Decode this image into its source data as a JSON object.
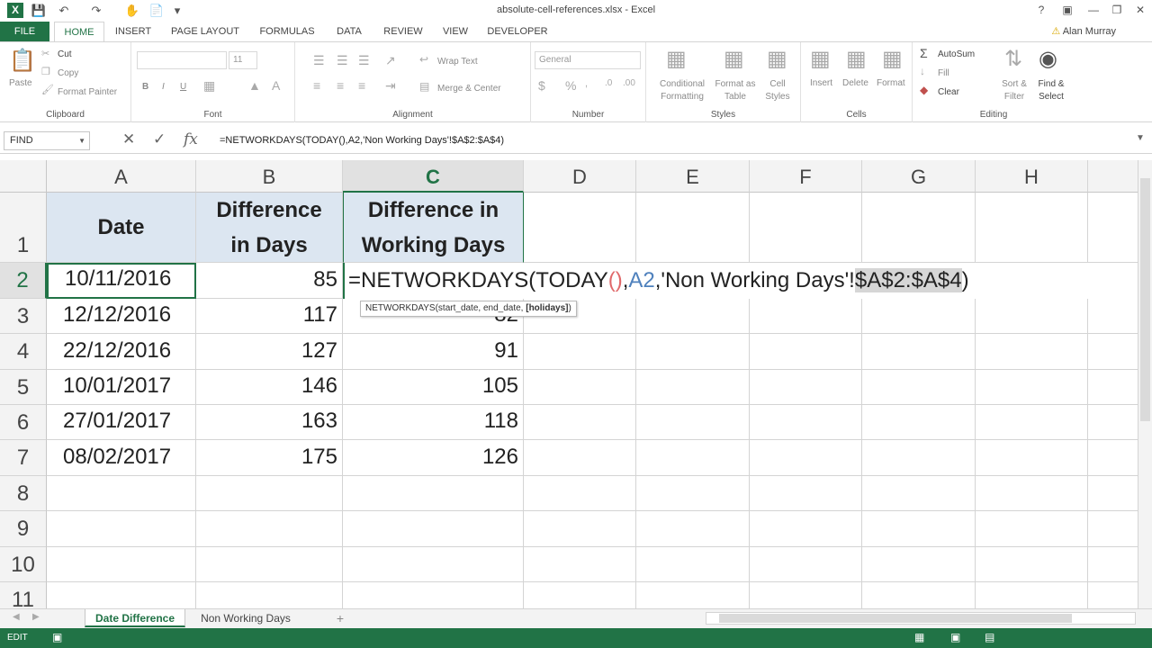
{
  "titlebar": {
    "title": "absolute-cell-references.xlsx - Excel",
    "logo": "X",
    "help": "?",
    "icons": [
      "save-icon",
      "undo-icon",
      "redo-icon",
      "minimize-icon",
      "restore-icon",
      "close-icon"
    ]
  },
  "tabs": {
    "file": "FILE",
    "items": [
      "HOME",
      "INSERT",
      "PAGE LAYOUT",
      "FORMULAS",
      "DATA",
      "REVIEW",
      "VIEW",
      "DEVELOPER"
    ],
    "active": "HOME",
    "user": "Alan Murray"
  },
  "ribbon": {
    "clipboard": {
      "label": "Clipboard",
      "paste": "Paste",
      "cut": "Cut",
      "copy": "Copy",
      "format_painter": "Format Painter"
    },
    "font": {
      "label": "Font",
      "size": "11",
      "bold": "B",
      "italic": "I",
      "underline": "U"
    },
    "alignment": {
      "label": "Alignment",
      "wrap": "Wrap Text",
      "merge": "Merge & Center"
    },
    "number": {
      "label": "Number",
      "format": "General"
    },
    "styles": {
      "label": "Styles",
      "conditional": "Conditional Formatting",
      "format_table": "Format as Table",
      "cell_styles": "Cell Styles"
    },
    "cells": {
      "label": "Cells",
      "insert": "Insert",
      "delete": "Delete",
      "format": "Format"
    },
    "editing": {
      "label": "Editing",
      "autosum": "AutoSum",
      "fill": "Fill",
      "clear": "Clear",
      "sort": "Sort & Filter",
      "find": "Find & Select"
    }
  },
  "formula_bar": {
    "name_box": "FIND",
    "formula": "=NETWORKDAYS(TODAY(),A2,'Non Working Days'!$A$2:$A$4)"
  },
  "grid": {
    "columns": [
      "A",
      "B",
      "C",
      "D",
      "E",
      "F",
      "G",
      "H"
    ],
    "selected_column": "C",
    "rows": [
      "1",
      "2",
      "3",
      "4",
      "5",
      "6",
      "7",
      "8",
      "9",
      "10",
      "11"
    ],
    "selected_row": "2",
    "headers": {
      "A": "Date",
      "B": [
        "Difference",
        "in Days"
      ],
      "C": [
        "Difference in",
        "Working Days"
      ]
    },
    "data": [
      {
        "date": "10/11/2016",
        "days": "85",
        "work": ""
      },
      {
        "date": "12/12/2016",
        "days": "117",
        "work": "82"
      },
      {
        "date": "22/12/2016",
        "days": "127",
        "work": "91"
      },
      {
        "date": "10/01/2017",
        "days": "146",
        "work": "105"
      },
      {
        "date": "27/01/2017",
        "days": "163",
        "work": "118"
      },
      {
        "date": "08/02/2017",
        "days": "175",
        "work": "126"
      }
    ],
    "edit": {
      "part1": "=NETWORKDAYS(TODAY",
      "paren": "()",
      "comma1": ",",
      "ref": "A2",
      "part2": ",'Non Working Days'!",
      "highlight": "$A$2:$A$4",
      "close": ")"
    },
    "tooltip": {
      "text": "NETWORKDAYS(start_date, end_date, ",
      "bold": "[holidays]",
      "end": ")"
    }
  },
  "sheets": {
    "tabs": [
      "Date Difference",
      "Non Working Days"
    ],
    "active": "Date Difference",
    "add": "+"
  },
  "status": {
    "mode": "EDIT"
  },
  "colors": {
    "accent": "#217346",
    "header_fill": "#dce6f1",
    "highlight": "#d6d6d6"
  }
}
